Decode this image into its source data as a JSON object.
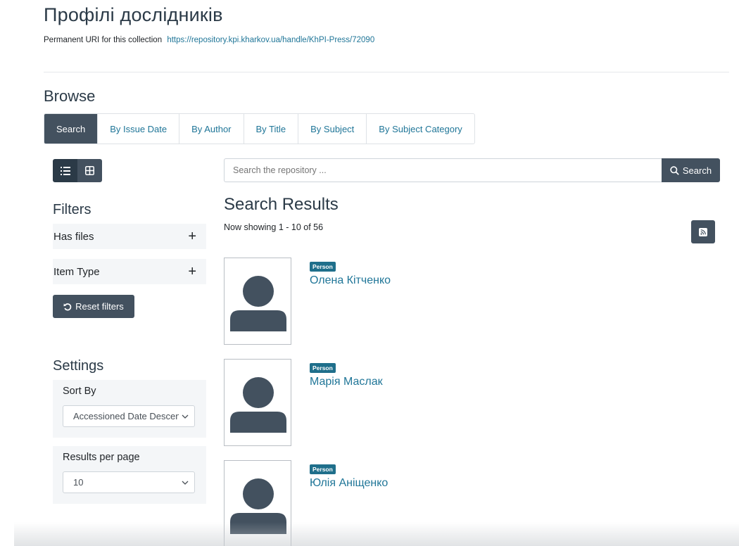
{
  "header": {
    "title": "Профілі дослідників",
    "uri_label": "Permanent URI for this collection",
    "uri_link": "https://repository.kpi.kharkov.ua/handle/KhPI-Press/72090"
  },
  "browse": {
    "heading": "Browse",
    "tabs": [
      {
        "label": "Search",
        "active": true
      },
      {
        "label": "By Issue Date",
        "active": false
      },
      {
        "label": "By Author",
        "active": false
      },
      {
        "label": "By Title",
        "active": false
      },
      {
        "label": "By Subject",
        "active": false
      },
      {
        "label": "By Subject Category",
        "active": false
      }
    ]
  },
  "view_toggle": {
    "list_icon": "list-icon",
    "grid_icon": "grid-icon",
    "selected": "list"
  },
  "search": {
    "placeholder": "Search the repository ...",
    "button_label": "Search"
  },
  "filters": {
    "heading": "Filters",
    "facets": [
      {
        "label": "Has files"
      },
      {
        "label": "Item Type"
      }
    ],
    "reset_label": "Reset filters"
  },
  "settings": {
    "heading": "Settings",
    "sort_label": "Sort By",
    "sort_value": "Accessioned Date Descending",
    "rpp_label": "Results per page",
    "rpp_value": "10"
  },
  "results": {
    "heading": "Search Results",
    "showing": "Now showing 1 - 10 of 56",
    "items": [
      {
        "badge": "Person",
        "name": "Олена Кітченко"
      },
      {
        "badge": "Person",
        "name": "Марія Маслак"
      },
      {
        "badge": "Person",
        "name": "Юлія Аніщенко"
      }
    ]
  },
  "colors": {
    "primary": "#43515f",
    "link": "#207698",
    "badge": "#1f6f8b"
  }
}
